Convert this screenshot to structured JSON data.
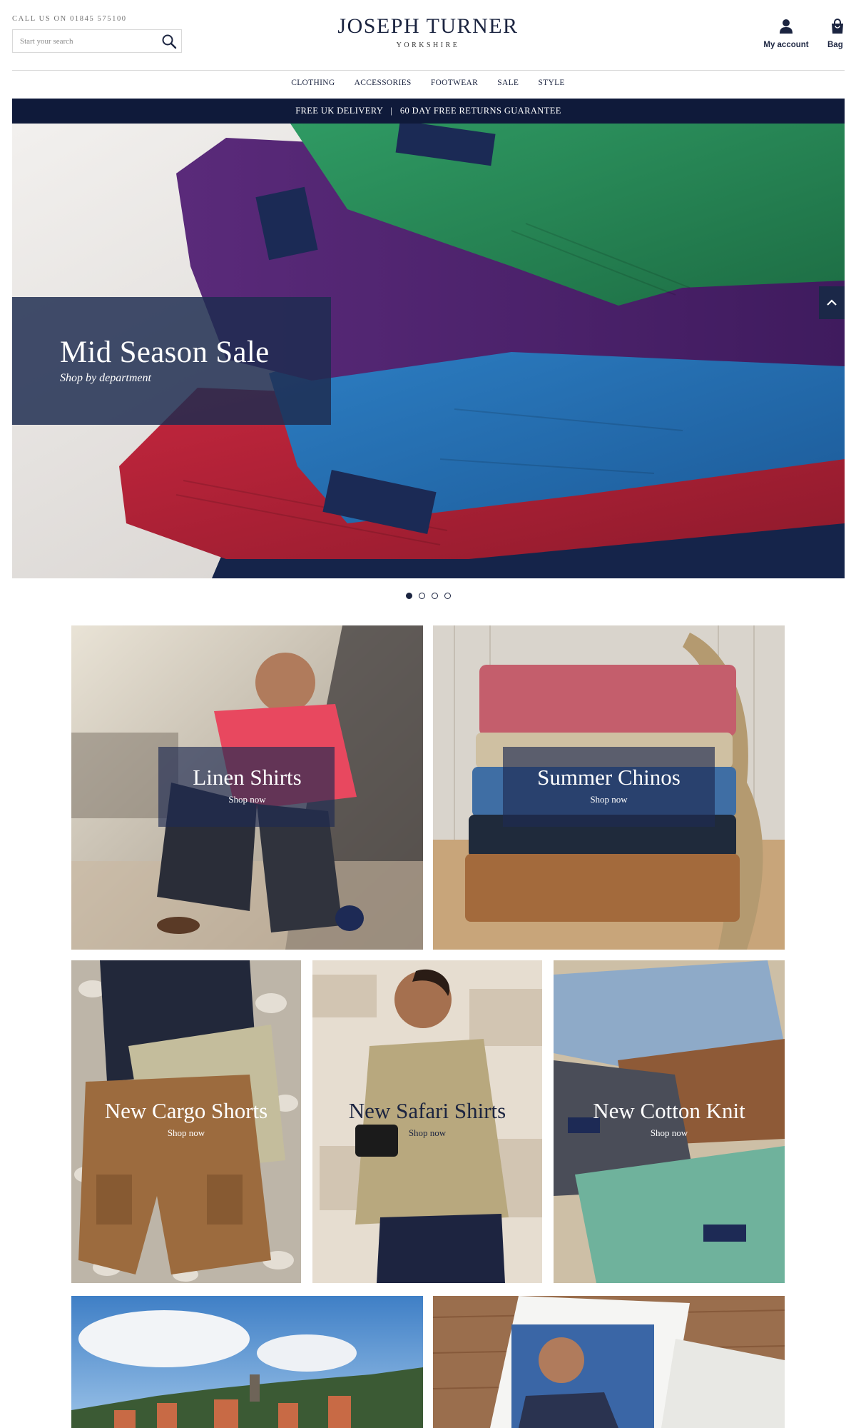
{
  "header": {
    "call_us": "CALL US ON 01845 575100",
    "search_placeholder": "Start your search",
    "logo_main": "JOSEPH TURNER",
    "logo_sub": "YORKSHIRE",
    "account_label": "My account",
    "bag_label": "Bag"
  },
  "nav": {
    "items": [
      {
        "label": "CLOTHING"
      },
      {
        "label": "ACCESSORIES"
      },
      {
        "label": "FOOTWEAR"
      },
      {
        "label": "SALE"
      },
      {
        "label": "STYLE"
      }
    ]
  },
  "promo": {
    "text": "FREE UK DELIVERY   |   60 DAY FREE RETURNS GUARANTEE"
  },
  "hero": {
    "title": "Mid Season Sale",
    "subtitle": "Shop by department",
    "slide_count": 4,
    "active_slide": 1
  },
  "tiles": [
    {
      "title": "Linen Shirts",
      "cta": "Shop now"
    },
    {
      "title": "Summer Chinos",
      "cta": "Shop now"
    },
    {
      "title": "New Cargo Shorts",
      "cta": "Shop now"
    },
    {
      "title": "New Safari Shirts",
      "cta": "Shop now"
    },
    {
      "title": "New Cotton Knit",
      "cta": "Shop now"
    }
  ],
  "icons": {
    "search": "search-icon",
    "account": "user-icon",
    "bag": "shopping-bag-icon",
    "scroll_top": "chevron-up-icon"
  },
  "colors": {
    "brand_navy": "#1b2440",
    "promo_bar": "#0f1a3a",
    "panel_overlay": "#1e2c50"
  }
}
